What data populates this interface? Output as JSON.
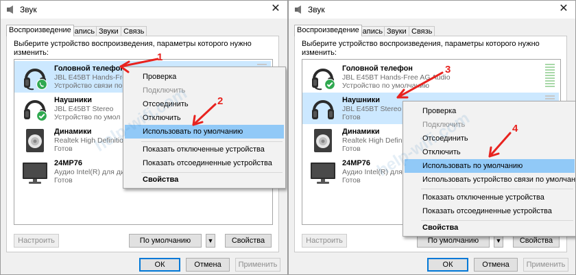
{
  "dialogs": [
    {
      "title": "Звук",
      "tabs": [
        "Воспроизведение",
        "Запись",
        "Звуки",
        "Связь"
      ],
      "instruction": "Выберите устройство воспроизведения, параметры которого нужно изменить:",
      "devices": [
        {
          "name": "Головной телефон",
          "desc": "JBL E45BT Hands-Free",
          "status": "Устройство связи по",
          "icon": "headset-icon",
          "badge": "phone-badge-icon"
        },
        {
          "name": "Наушники",
          "desc": "JBL E45BT Stereo",
          "status": "Устройство по умол",
          "icon": "headphones-icon",
          "badge": "check-badge-icon"
        },
        {
          "name": "Динамики",
          "desc": "Realtek High Definitio",
          "status": "Готов",
          "icon": "speaker-icon",
          "badge": ""
        },
        {
          "name": "24MP76",
          "desc": "Аудио Intel(R) для дис",
          "status": "Готов",
          "icon": "monitor-icon",
          "badge": ""
        }
      ],
      "context_menu": [
        {
          "label": "Проверка",
          "state": "normal"
        },
        {
          "label": "Подключить",
          "state": "disabled"
        },
        {
          "label": "Отсоединить",
          "state": "normal"
        },
        {
          "label": "Отключить",
          "state": "normal"
        },
        {
          "label": "Использовать по умолчанию",
          "state": "highlight"
        },
        {
          "label": "Показать отключенные устройства",
          "state": "normal"
        },
        {
          "label": "Показать отсоединенные устройства",
          "state": "normal"
        },
        {
          "label": "Свойства",
          "state": "bold"
        }
      ],
      "buttons": {
        "configure": "Настроить",
        "default": "По умолчанию",
        "properties": "Свойства",
        "ok": "ОК",
        "cancel": "Отмена",
        "apply": "Применить"
      },
      "callouts": [
        "1",
        "2"
      ]
    },
    {
      "title": "Звук",
      "tabs": [
        "Воспроизведение",
        "Запись",
        "Звуки",
        "Связь"
      ],
      "instruction": "Выберите устройство воспроизведения, параметры которого нужно изменить:",
      "devices": [
        {
          "name": "Головной телефон",
          "desc": "JBL E45BT Hands-Free AG Audio",
          "status": "Устройство по умолчанию",
          "icon": "headset-icon",
          "badge": "check-badge-icon"
        },
        {
          "name": "Наушники",
          "desc": "JBL E45BT Stereo",
          "status": "Готов",
          "icon": "headphones-icon",
          "badge": ""
        },
        {
          "name": "Динамики",
          "desc": "Realtek High Definit",
          "status": "Готов",
          "icon": "speaker-icon",
          "badge": ""
        },
        {
          "name": "24MP76",
          "desc": "Аудио Intel(R) для д",
          "status": "Готов",
          "icon": "monitor-icon",
          "badge": ""
        }
      ],
      "context_menu": [
        {
          "label": "Проверка",
          "state": "normal"
        },
        {
          "label": "Подключить",
          "state": "disabled"
        },
        {
          "label": "Отсоединить",
          "state": "normal"
        },
        {
          "label": "Отключить",
          "state": "normal"
        },
        {
          "label": "Использовать по умолчанию",
          "state": "highlight"
        },
        {
          "label": "Использовать устройство связи по умолчанию",
          "state": "normal"
        },
        {
          "label": "Показать отключенные устройства",
          "state": "normal"
        },
        {
          "label": "Показать отсоединенные устройства",
          "state": "normal"
        },
        {
          "label": "Свойства",
          "state": "bold"
        }
      ],
      "buttons": {
        "configure": "Настроить",
        "default": "По умолчанию",
        "properties": "Свойства",
        "ok": "ОК",
        "cancel": "Отмена",
        "apply": "Применить"
      },
      "callouts": [
        "3",
        "4"
      ]
    }
  ],
  "watermark": "help-wifi.com",
  "colors": {
    "selection": "#cce8ff",
    "menu_highlight": "#91c9f7",
    "accent": "#0078d7",
    "callout": "#e8231f",
    "badge_green": "#2fa84f"
  }
}
